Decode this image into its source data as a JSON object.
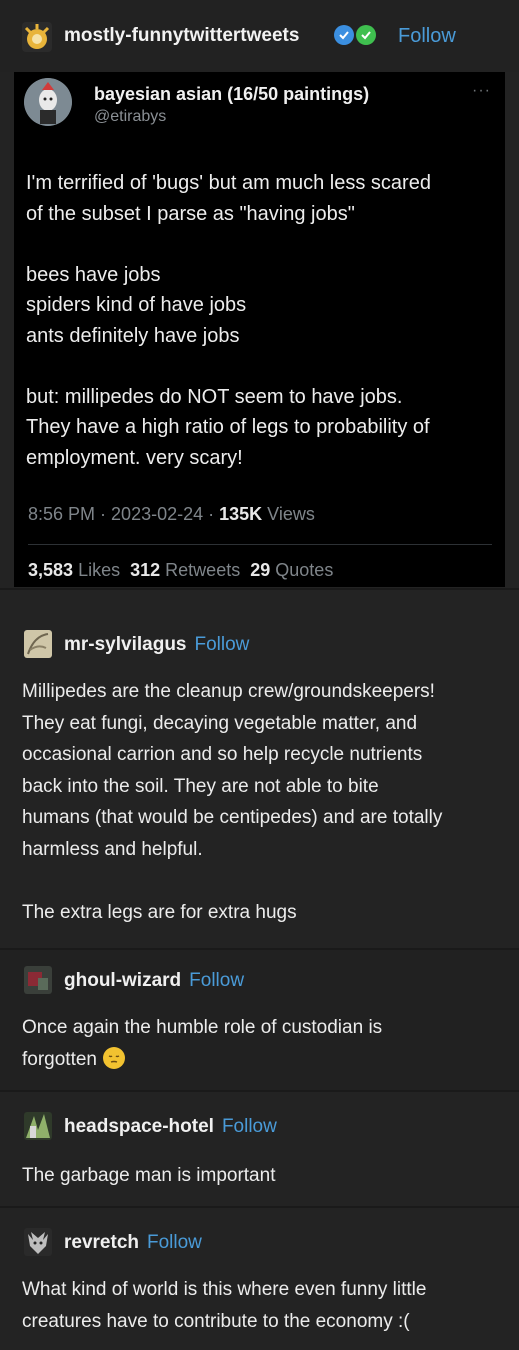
{
  "header": {
    "blog_name": "mostly-funnytwittertweets",
    "follow": "Follow",
    "badge_colors": [
      "#3b8fe0",
      "#3fbf4f"
    ]
  },
  "tweet": {
    "display_name": "bayesian asian (16/50 paintings)",
    "handle": "@etirabys",
    "more_icon": "ellipsis-icon",
    "paragraphs": [
      [
        "I'm terrified of 'bugs' but am much less scared",
        "of the subset I parse as \"having jobs\""
      ],
      [
        "bees have jobs",
        "spiders kind of have jobs",
        "ants definitely have jobs"
      ],
      [
        "but: millipedes do NOT seem to have jobs.",
        "They have a high ratio of legs to probability of",
        "employment. very scary!"
      ]
    ],
    "time": "8:56 PM",
    "date": "2023-02-24",
    "views_count": "135K",
    "views_label": "Views",
    "likes_count": "3,583",
    "likes_label": "Likes",
    "retweets_count": "312",
    "retweets_label": "Retweets",
    "quotes_count": "29",
    "quotes_label": "Quotes"
  },
  "replies": [
    {
      "name": "mr-sylvilagus",
      "follow": "Follow",
      "lines": [
        "Millipedes are the cleanup crew/groundskeepers!",
        "They eat fungi, decaying vegetable matter, and",
        "occasional carrion and so help recycle nutrients",
        "back into the soil. They are not able to bite",
        "humans (that would be centipedes) and are totally",
        "harmless and helpful."
      ],
      "extra": "The extra legs are for extra hugs"
    },
    {
      "name": "ghoul-wizard",
      "follow": "Follow",
      "lines": [
        "Once again the humble role of custodian is",
        "forgotten"
      ],
      "emoji": "pensive-face-emoji"
    },
    {
      "name": "headspace-hotel",
      "follow": "Follow",
      "lines": [
        "The garbage man is important"
      ]
    },
    {
      "name": "revretch",
      "follow": "Follow",
      "lines": [
        "What kind of world is this where even funny little",
        "creatures have to contribute to the economy :("
      ]
    }
  ],
  "colors": {
    "link_blue": "#4a9bd8",
    "background": "#232323",
    "tweet_background": "#000000"
  }
}
